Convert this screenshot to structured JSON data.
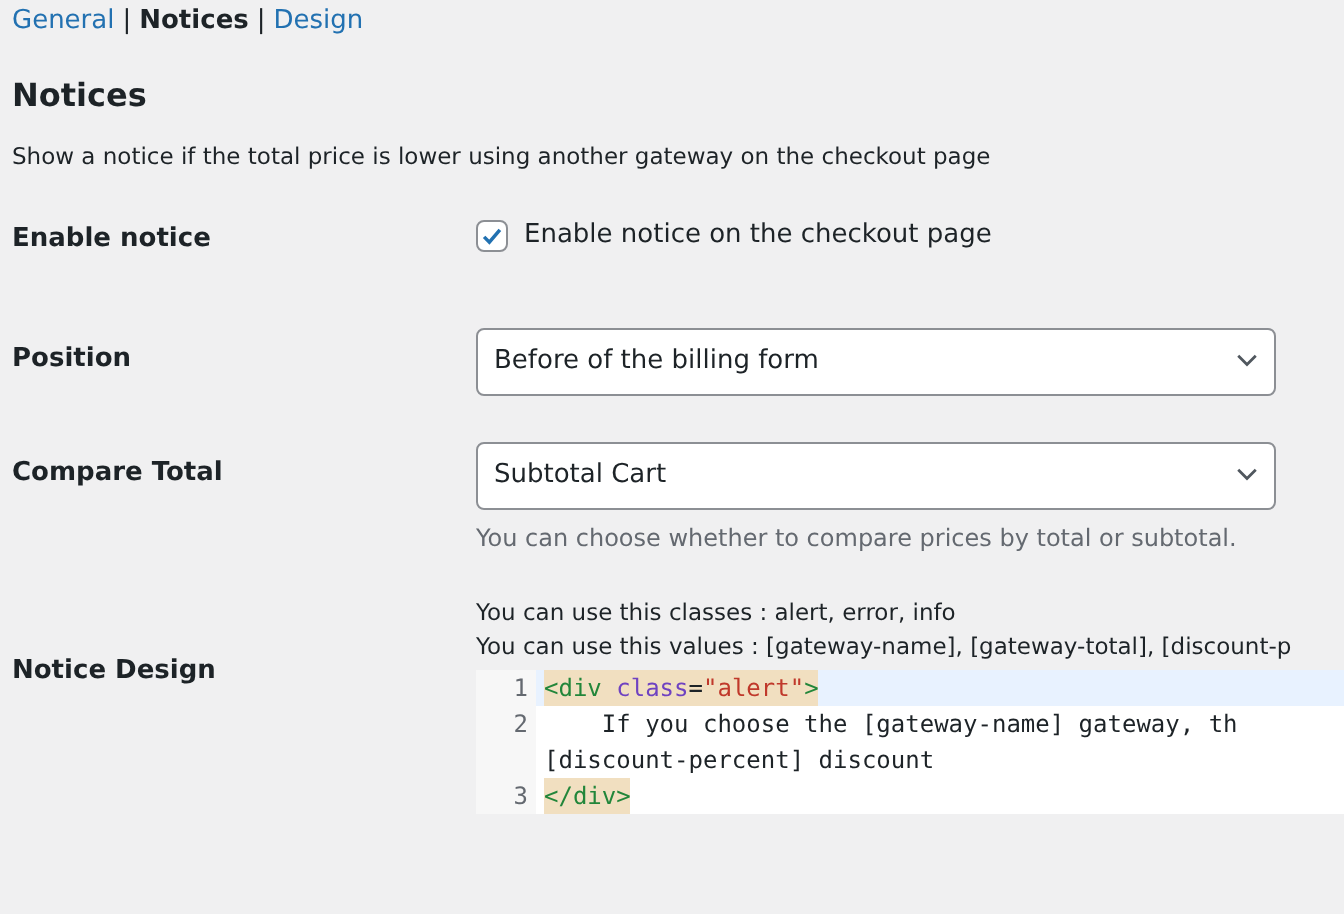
{
  "tabs": [
    {
      "label": "General",
      "selected": false
    },
    {
      "label": "Notices",
      "selected": true,
      "divider": "|"
    },
    {
      "label": "Design",
      "selected": false,
      "divider": "|"
    }
  ],
  "heading": "Notices",
  "description": "Show a notice if the total price is lower using another gateway on the checkout page",
  "fields": [
    {
      "kind": "checkbox",
      "label": "Enable notice",
      "option": "Enable notice on the checkout page",
      "checked": true
    },
    {
      "kind": "select",
      "label": "Position",
      "value": "Before of the billing form"
    },
    {
      "kind": "select",
      "label": "Compare Total",
      "value": "Subtotal Cart",
      "help": "You can choose whether to compare prices by total or subtotal."
    },
    {
      "kind": "code",
      "label": "Notice Design",
      "notes": [
        "You can use this classes : alert, error, info",
        "You can use this values : [gateway-name], [gateway-total], [discount-p"
      ],
      "lines": [
        {
          "number": "1",
          "active": true,
          "rows": [
            [
              {
                "kind": "tag",
                "text": "<div",
                "matched": true
              },
              {
                "kind": "attr",
                "text": " class",
                "matched": true
              },
              {
                "kind": "plain",
                "text": "=",
                "matched": true
              },
              {
                "kind": "string",
                "text": "\"alert\"",
                "matched": true
              },
              {
                "kind": "tag",
                "text": ">",
                "matched": true
              }
            ]
          ]
        },
        {
          "number": "2",
          "active": false,
          "rows": [
            [
              {
                "kind": "plain",
                "text": "    If you choose the [gateway-name] gateway, th",
                "matched": false
              }
            ],
            [
              {
                "kind": "plain",
                "text": "[discount-percent] discount",
                "matched": false
              }
            ]
          ]
        },
        {
          "number": "3",
          "active": false,
          "rows": [
            [
              {
                "kind": "tag",
                "text": "</div>",
                "matched": true
              }
            ]
          ]
        }
      ]
    }
  ]
}
